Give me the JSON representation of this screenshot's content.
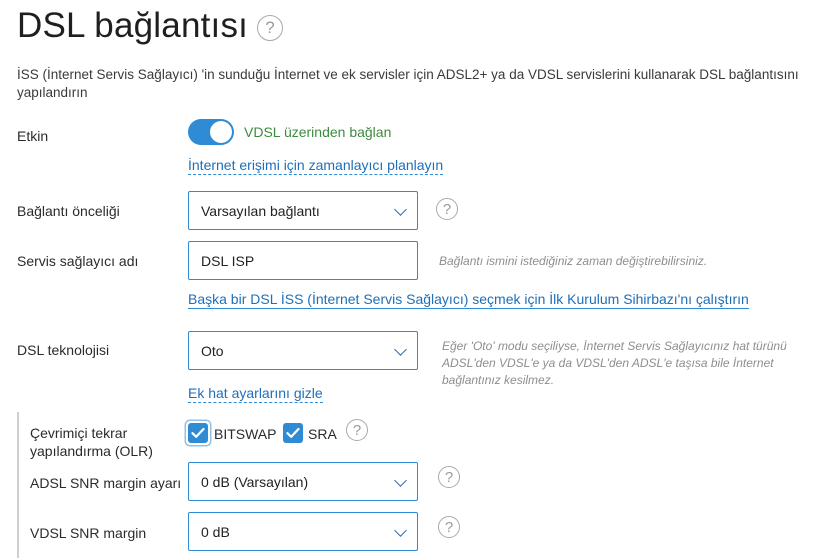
{
  "page": {
    "title": "DSL bağlantısı",
    "description": "İSS (İnternet Servis Sağlayıcı) 'in sunduğu İnternet ve ek servisler için ADSL2+ ya da VDSL servislerini kullanarak DSL bağlantısını yapılandırın"
  },
  "enabled": {
    "label": "Etkin",
    "toggle_on": true,
    "toggle_text": "VDSL üzerinden bağlan",
    "schedule_link": "İnternet erişimi için zamanlayıcı planlayın"
  },
  "priority": {
    "label": "Bağlantı önceliği",
    "value": "Varsayılan bağlantı"
  },
  "provider": {
    "label": "Servis sağlayıcı adı",
    "value": "DSL ISP",
    "hint": "Bağlantı ismini istediğiniz zaman değiştirebilirsiniz.",
    "wizard_link": "Başka bir DSL İSS (İnternet Servis Sağlayıcı) seçmek için İlk Kurulum Sihirbazı'nı çalıştırın"
  },
  "technology": {
    "label": "DSL teknolojisi",
    "value": "Oto",
    "hint": "Eğer 'Oto' modu seçiliyse, İnternet Servis Sağlayıcınız hat türünü ADSL'den VDSL'e ya da VDSL'den ADSL'e taşısa bile İnternet bağlantınız kesilmez.",
    "hide_link": "Ek hat ayarlarını gizle"
  },
  "olr": {
    "label": "Çevrimiçi tekrar yapılandırma (OLR)",
    "bitswap_label": "BITSWAP",
    "bitswap_checked": true,
    "sra_label": "SRA",
    "sra_checked": true
  },
  "adsl_snr": {
    "label": "ADSL SNR margin ayarı",
    "value": "0 dB (Varsayılan)"
  },
  "vdsl_snr": {
    "label": "VDSL SNR margin",
    "value": "0 dB"
  },
  "icons": {
    "help": "question-mark-icon",
    "help_glyph": "?",
    "check": "checkmark-icon",
    "chevron": "chevron-down-icon"
  },
  "colors": {
    "accent": "#2f8bd3",
    "link": "#1f6fb8",
    "toggle_text": "#3e8b3e",
    "hint": "#8e8e8e"
  }
}
